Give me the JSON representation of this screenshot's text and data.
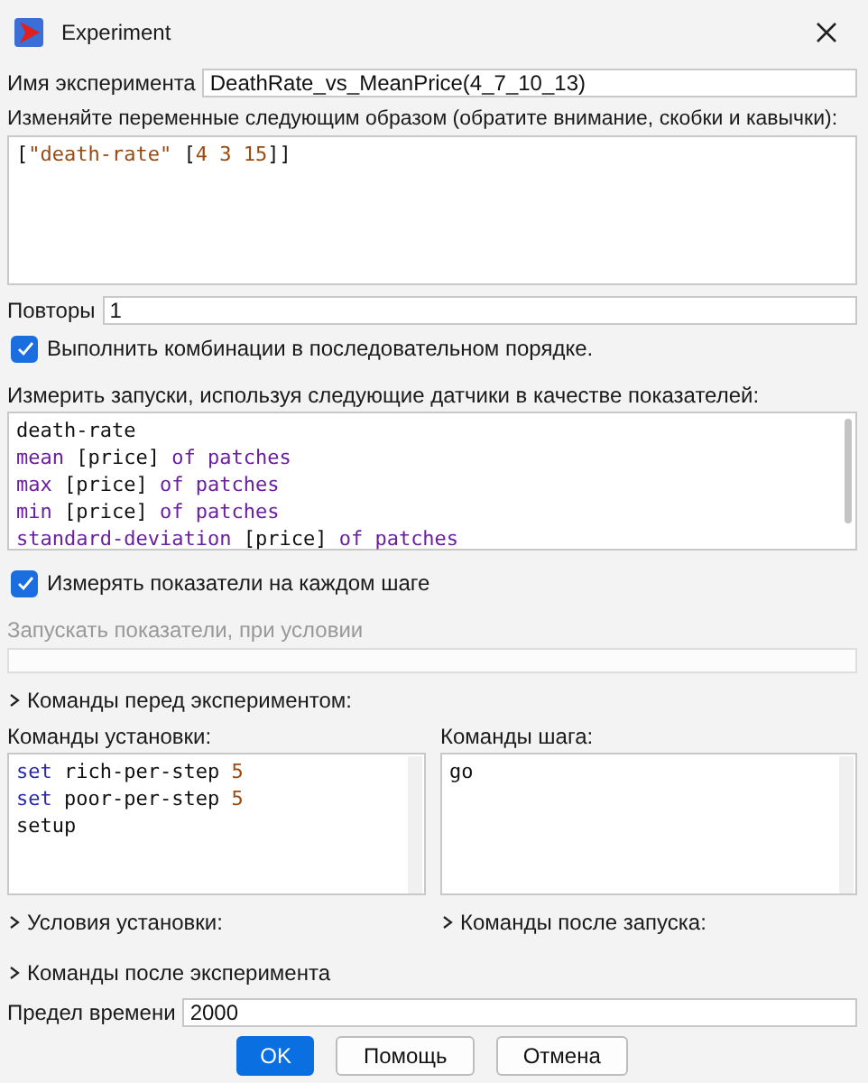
{
  "window": {
    "title": "Experiment"
  },
  "name_field": {
    "label": "Имя эксперимента",
    "value": "DeathRate_vs_MeanPrice(4_7_10_13)"
  },
  "variables": {
    "label": "Изменяйте переменные следующим образом (обратите внимание, скобки и кавычки):",
    "lines": [
      [
        {
          "text": "[",
          "kind": "plain"
        },
        {
          "text": "\"death-rate\"",
          "kind": "string"
        },
        {
          "text": " [",
          "kind": "plain"
        },
        {
          "text": "4 3 15",
          "kind": "number"
        },
        {
          "text": "]]",
          "kind": "plain"
        }
      ]
    ]
  },
  "repetitions": {
    "label": "Повторы",
    "value": "1"
  },
  "sequential": {
    "label": "Выполнить комбинации в последовательном порядке.",
    "checked": true
  },
  "metrics": {
    "label": "Измерить запуски, используя следующие датчики в качестве показателей:",
    "lines": [
      [
        {
          "text": "death-rate",
          "kind": "plain"
        }
      ],
      [
        {
          "text": "mean",
          "kind": "reporter"
        },
        {
          "text": " [price] ",
          "kind": "plain"
        },
        {
          "text": "of patches",
          "kind": "reporter"
        }
      ],
      [
        {
          "text": "max",
          "kind": "reporter"
        },
        {
          "text": " [price] ",
          "kind": "plain"
        },
        {
          "text": "of patches",
          "kind": "reporter"
        }
      ],
      [
        {
          "text": "min",
          "kind": "reporter"
        },
        {
          "text": " [price] ",
          "kind": "plain"
        },
        {
          "text": "of patches",
          "kind": "reporter"
        }
      ],
      [
        {
          "text": "standard-deviation",
          "kind": "reporter"
        },
        {
          "text": " [price] ",
          "kind": "plain"
        },
        {
          "text": "of patches",
          "kind": "reporter"
        }
      ]
    ]
  },
  "every_step": {
    "label": "Измерять показатели на каждом шаге",
    "checked": true
  },
  "run_condition": {
    "label": "Запускать показатели, при условии",
    "disabled": true
  },
  "pre_experiment": {
    "label": "Команды перед экспериментом:",
    "expanded": false
  },
  "setup_commands": {
    "label": "Команды установки:",
    "lines": [
      [
        {
          "text": "set",
          "kind": "command"
        },
        {
          "text": " rich-per-step ",
          "kind": "plain"
        },
        {
          "text": "5",
          "kind": "number"
        }
      ],
      [
        {
          "text": "set",
          "kind": "command"
        },
        {
          "text": " poor-per-step ",
          "kind": "plain"
        },
        {
          "text": "5",
          "kind": "number"
        }
      ],
      [
        {
          "text": "setup",
          "kind": "plain"
        }
      ]
    ]
  },
  "go_commands": {
    "label": "Команды шага:",
    "lines": [
      [
        {
          "text": "go",
          "kind": "plain"
        }
      ]
    ]
  },
  "setup_conditions": {
    "label": "Условия установки:",
    "expanded": false
  },
  "post_run": {
    "label": "Команды после запуска:",
    "expanded": false
  },
  "post_experiment": {
    "label": "Команды после эксперимента",
    "expanded": false
  },
  "time_limit": {
    "label": "Предел времени",
    "value": "2000"
  },
  "buttons": [
    {
      "label": "OK",
      "kind": "primary"
    },
    {
      "label": "Помощь",
      "kind": "normal"
    },
    {
      "label": "Отмена",
      "kind": "normal"
    }
  ]
}
